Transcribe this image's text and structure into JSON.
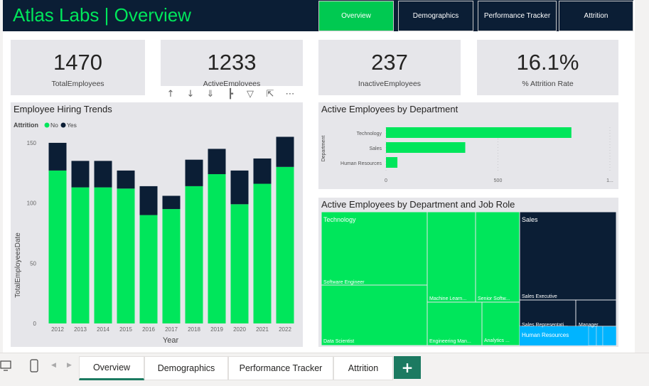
{
  "header": {
    "title": "Atlas Labs | Overview",
    "nav": [
      "Overview",
      "Demographics",
      "Performance Tracker",
      "Attrition"
    ],
    "active_nav": "Overview"
  },
  "kpis": [
    {
      "value": "1470",
      "label": "TotalEmployees"
    },
    {
      "value": "1233",
      "label": "ActiveEmployees"
    },
    {
      "value": "237",
      "label": "InactiveEmployees"
    },
    {
      "value": "16.1%",
      "label": "% Attrition Rate"
    }
  ],
  "toolbar": {
    "icons": [
      "drill-up-icon",
      "drill-down-icon",
      "expand-all-icon",
      "expand-level-icon",
      "filter-icon",
      "focus-mode-icon",
      "more-options-icon"
    ]
  },
  "hiring_chart": {
    "title": "Employee Hiring Trends",
    "legend_title": "Attrition",
    "legend_items": [
      "No",
      "Yes"
    ],
    "colors": {
      "No": "#00e65b",
      "Yes": "#0b1e35"
    }
  },
  "dept_chart": {
    "title": "Active Employees by Department",
    "colors": {
      "bar": "#00e65b"
    }
  },
  "treemap": {
    "title": "Active Employees by Department and Job Role",
    "groups": [
      {
        "name": "Technology",
        "color": "#00e65b",
        "text_color": "#ffffff"
      },
      {
        "name": "Sales",
        "color": "#0b1e35",
        "text_color": "#ffffff"
      },
      {
        "name": "Human Resources",
        "color": "#00b4ff",
        "text_color": "#ffffff"
      }
    ],
    "leaves": [
      "Software Engineer",
      "Data Scientist",
      "Machine Learn...",
      "Senior Softw...",
      "Engineering Man...",
      "Analytics ...",
      "Sales Executive",
      "Sales Representati...",
      "Manager"
    ]
  },
  "page_tabs": [
    "Overview",
    "Demographics",
    "Performance Tracker",
    "Attrition"
  ],
  "active_tab": "Overview",
  "add_page_label": "+",
  "chart_data": [
    {
      "type": "bar",
      "stacked": true,
      "title": "Employee Hiring Trends",
      "xlabel": "Year",
      "ylabel": "TotalEmployeesDate",
      "categories": [
        "2012",
        "2013",
        "2014",
        "2015",
        "2016",
        "2017",
        "2018",
        "2019",
        "2020",
        "2021",
        "2022"
      ],
      "series": [
        {
          "name": "No",
          "values": [
            127,
            113,
            113,
            112,
            90,
            95,
            114,
            124,
            99,
            116,
            130
          ]
        },
        {
          "name": "Yes",
          "values": [
            23,
            22,
            22,
            15,
            24,
            11,
            22,
            21,
            28,
            21,
            25
          ]
        }
      ],
      "yticks": [
        0,
        50,
        100,
        150
      ],
      "ylim": [
        0,
        160
      ],
      "legend": "top-left",
      "grid": false
    },
    {
      "type": "bar",
      "orientation": "horizontal",
      "title": "Active Employees by Department",
      "ylabel": "Department",
      "categories": [
        "Technology",
        "Sales",
        "Human Resources"
      ],
      "values": [
        828,
        354,
        51
      ],
      "xticks": [
        "0",
        "500",
        "1..."
      ],
      "xlim": [
        0,
        1000
      ],
      "grid": true
    }
  ]
}
